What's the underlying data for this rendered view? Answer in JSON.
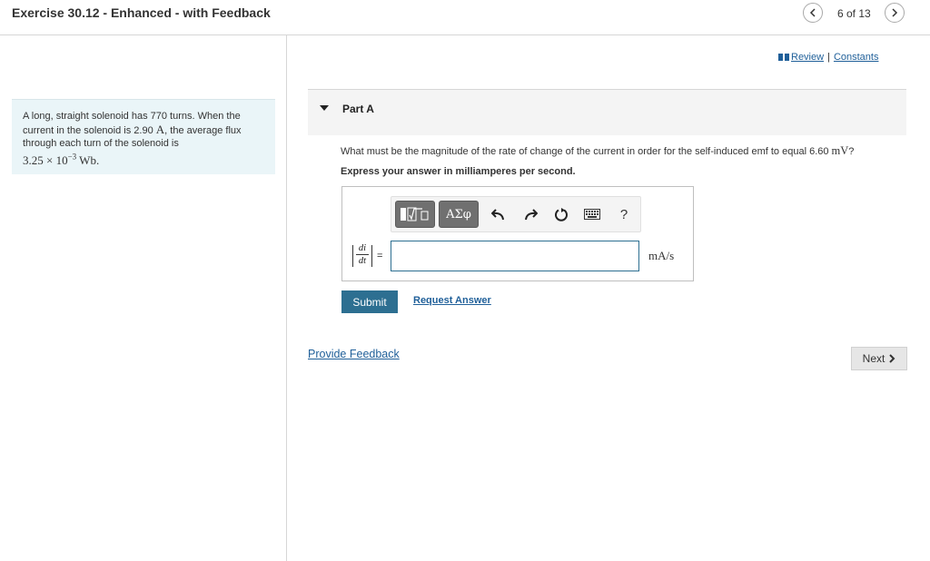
{
  "header": {
    "title": "Exercise 30.12 - Enhanced - with Feedback",
    "page_count": "6 of 13"
  },
  "problem": {
    "text_1": "A long, straight solenoid has 770 turns. When the current in the solenoid is 2.90 ",
    "current_unit": "A",
    "text_2": ", the average flux through each turn of the solenoid is",
    "flux_mantissa": "3.25 × 10",
    "flux_exponent": "−3",
    "flux_unit": " Wb."
  },
  "links": {
    "review": "Review",
    "separator": "|",
    "constants": "Constants"
  },
  "part": {
    "title": "Part A",
    "question_text": "What must be the magnitude of the rate of change of the current in order for the self-induced emf to equal 6.60 ",
    "question_unit": "mV",
    "question_end": "?",
    "instruction": "Express your answer in milliamperes per second.",
    "toolbar": {
      "greek_label": "ΑΣφ",
      "help_label": "?"
    },
    "formula_num": "di",
    "formula_den": "dt",
    "equals": "=",
    "answer_value": "",
    "units": "mA/s",
    "submit_label": "Submit",
    "request_label": "Request Answer"
  },
  "footer": {
    "feedback_label": "Provide Feedback",
    "next_label": "Next"
  },
  "colors": {
    "accent": "#2d6f91",
    "link": "#1f5f99",
    "problem_bg": "#eaf5f8"
  },
  "icons": [
    "chevron-left-icon",
    "chevron-right-icon",
    "book-icon",
    "caret-down-icon",
    "template-icon",
    "undo-icon",
    "redo-icon",
    "reset-icon",
    "keyboard-icon",
    "help-icon",
    "next-chevron-icon"
  ]
}
